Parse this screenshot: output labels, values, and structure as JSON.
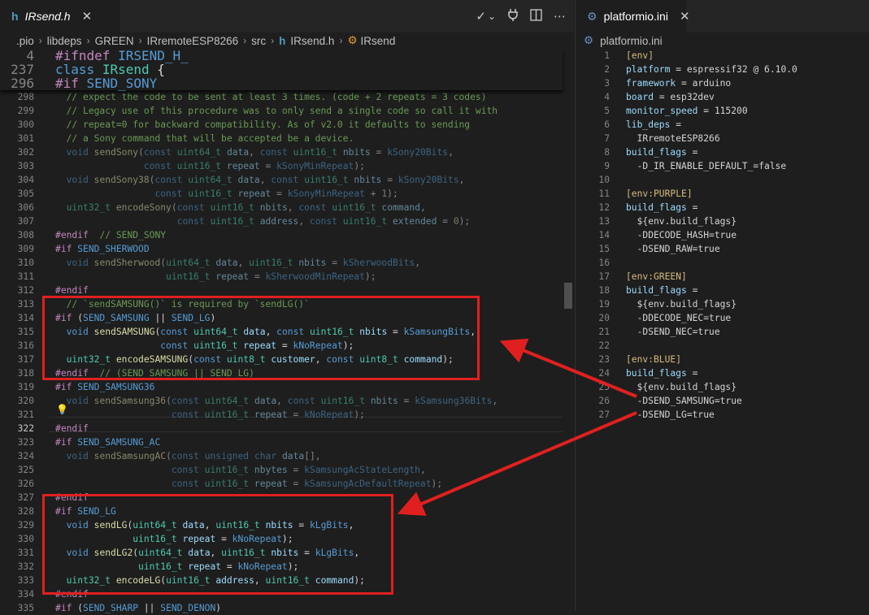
{
  "left_tab": {
    "icon": "h",
    "title": "IRsend.h",
    "close": "✕"
  },
  "left_actions": [
    "✓",
    "⌄",
    "⚲",
    "▯",
    "⋯"
  ],
  "breadcrumb": [
    ".pio",
    "libdeps",
    "GREEN",
    "IRremoteESP8266",
    "src",
    "IRsend.h",
    "IRsend"
  ],
  "sticky_lines": [
    {
      "n": "4",
      "t": "#ifndef IRSEND_H_"
    },
    {
      "n": "237",
      "t": "class IRsend {"
    },
    {
      "n": "296",
      "t": "#if SEND_SONY"
    }
  ],
  "code_lines": [
    {
      "n": "298",
      "t": "  // expect the code to be sent at least 3 times. (code + 2 repeats = 3 codes)"
    },
    {
      "n": "299",
      "t": "  // Legacy use of this procedure was to only send a single code so call it with"
    },
    {
      "n": "300",
      "t": "  // repeat=0 for backward compatibility. As of v2.0 it defaults to sending"
    },
    {
      "n": "301",
      "t": "  // a Sony command that will be accepted be a device."
    },
    {
      "n": "302",
      "t": "  void sendSony(const uint64_t data, const uint16_t nbits = kSony20Bits,"
    },
    {
      "n": "303",
      "t": "                const uint16_t repeat = kSonyMinRepeat);"
    },
    {
      "n": "304",
      "t": "  void sendSony38(const uint64_t data, const uint16_t nbits = kSony20Bits,"
    },
    {
      "n": "305",
      "t": "                  const uint16_t repeat = kSonyMinRepeat + 1);"
    },
    {
      "n": "306",
      "t": "  uint32_t encodeSony(const uint16_t nbits, const uint16_t command,"
    },
    {
      "n": "307",
      "t": "                      const uint16_t address, const uint16_t extended = 0);"
    },
    {
      "n": "308",
      "t": "#endif  // SEND_SONY"
    },
    {
      "n": "309",
      "t": "#if SEND_SHERWOOD"
    },
    {
      "n": "310",
      "t": "  void sendSherwood(uint64_t data, uint16_t nbits = kSherwoodBits,"
    },
    {
      "n": "311",
      "t": "                    uint16_t repeat = kSherwoodMinRepeat);"
    },
    {
      "n": "312",
      "t": "#endif"
    },
    {
      "n": "313",
      "t": "  // `sendSAMSUNG()` is required by `sendLG()`"
    },
    {
      "n": "314",
      "t": "#if (SEND_SAMSUNG || SEND_LG)"
    },
    {
      "n": "315",
      "t": "  void sendSAMSUNG(const uint64_t data, const uint16_t nbits = kSamsungBits,"
    },
    {
      "n": "316",
      "t": "                   const uint16_t repeat = kNoRepeat);"
    },
    {
      "n": "317",
      "t": "  uint32_t encodeSAMSUNG(const uint8_t customer, const uint8_t command);"
    },
    {
      "n": "318",
      "t": "#endif  // (SEND_SAMSUNG || SEND_LG)"
    },
    {
      "n": "319",
      "t": "#if SEND_SAMSUNG36"
    },
    {
      "n": "320",
      "t": "  void sendSamsung36(const uint64_t data, const uint16_t nbits = kSamsung36Bits,"
    },
    {
      "n": "321",
      "t": "                     const uint16_t repeat = kNoRepeat);"
    },
    {
      "n": "322",
      "t": "#endif"
    },
    {
      "n": "323",
      "t": "#if SEND_SAMSUNG_AC"
    },
    {
      "n": "324",
      "t": "  void sendSamsungAC(const unsigned char data[],"
    },
    {
      "n": "325",
      "t": "                     const uint16_t nbytes = kSamsungAcStateLength,"
    },
    {
      "n": "326",
      "t": "                     const uint16_t repeat = kSamsungAcDefaultRepeat);"
    },
    {
      "n": "327",
      "t": "#endif"
    },
    {
      "n": "328",
      "t": "#if SEND_LG"
    },
    {
      "n": "329",
      "t": "  void sendLG(uint64_t data, uint16_t nbits = kLgBits,"
    },
    {
      "n": "330",
      "t": "              uint16_t repeat = kNoRepeat);"
    },
    {
      "n": "331",
      "t": "  void sendLG2(uint64_t data, uint16_t nbits = kLgBits,"
    },
    {
      "n": "332",
      "t": "               uint16_t repeat = kNoRepeat);"
    },
    {
      "n": "333",
      "t": "  uint32_t encodeLG(uint16_t address, uint16_t command);"
    },
    {
      "n": "334",
      "t": "#endif"
    },
    {
      "n": "335",
      "t": "#if (SEND_SHARP || SEND_DENON)"
    }
  ],
  "right_tab": {
    "icon": "⚙",
    "title": "platformio.ini",
    "close": "✕"
  },
  "right_breadcrumb": "platformio.ini",
  "ini_lines": [
    {
      "n": "1",
      "t": "[env]"
    },
    {
      "n": "2",
      "t": "platform = espressif32 @ 6.10.0"
    },
    {
      "n": "3",
      "t": "framework = arduino"
    },
    {
      "n": "4",
      "t": "board = esp32dev"
    },
    {
      "n": "5",
      "t": "monitor_speed = 115200"
    },
    {
      "n": "6",
      "t": "lib_deps ="
    },
    {
      "n": "7",
      "t": "  IRremoteESP8266"
    },
    {
      "n": "8",
      "t": "build_flags ="
    },
    {
      "n": "9",
      "t": "  -D_IR_ENABLE_DEFAULT_=false"
    },
    {
      "n": "10",
      "t": ""
    },
    {
      "n": "11",
      "t": "[env:PURPLE]"
    },
    {
      "n": "12",
      "t": "build_flags ="
    },
    {
      "n": "13",
      "t": "  ${env.build_flags}"
    },
    {
      "n": "14",
      "t": "  -DDECODE_HASH=true"
    },
    {
      "n": "15",
      "t": "  -DSEND_RAW=true"
    },
    {
      "n": "16",
      "t": ""
    },
    {
      "n": "17",
      "t": "[env:GREEN]"
    },
    {
      "n": "18",
      "t": "build_flags ="
    },
    {
      "n": "19",
      "t": "  ${env.build_flags}"
    },
    {
      "n": "20",
      "t": "  -DDECODE_NEC=true"
    },
    {
      "n": "21",
      "t": "  -DSEND_NEC=true"
    },
    {
      "n": "22",
      "t": ""
    },
    {
      "n": "23",
      "t": "[env:BLUE]"
    },
    {
      "n": "24",
      "t": "build_flags ="
    },
    {
      "n": "25",
      "t": "  ${env.build_flags}"
    },
    {
      "n": "26",
      "t": "  -DSEND_SAMSUNG=true"
    },
    {
      "n": "27",
      "t": "  -DSEND_LG=true"
    }
  ],
  "current_line": "322",
  "colors": {
    "annotation": "#e02020",
    "keyword": "#c586c0",
    "type": "#4ec9b0",
    "function": "#dcdcaa",
    "comment": "#6a9955",
    "ini_section": "#d7ba7d",
    "ini_key": "#9cdcfe"
  }
}
